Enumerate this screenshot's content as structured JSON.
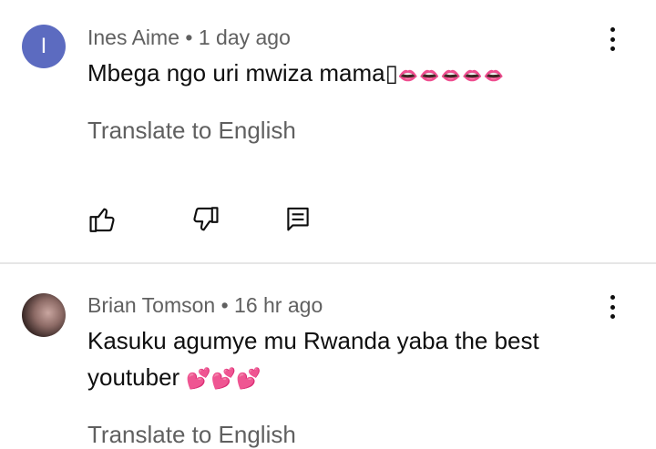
{
  "comments": [
    {
      "avatar_letter": "I",
      "author": "Ines Aime",
      "separator": "•",
      "time": "1 day ago",
      "text": "Mbega ngo uri mwiza mama",
      "missing_glyph": "▯",
      "emoji": "👄👄👄👄👄",
      "translate_label": "Translate to English",
      "menu_icon": "more-vert-icon",
      "actions": {
        "like_icon": "thumb-up-icon",
        "dislike_icon": "thumb-down-icon",
        "reply_icon": "reply-comment-icon"
      }
    },
    {
      "avatar": "profile-photo",
      "author": "Brian Tomson",
      "separator": "•",
      "time": "16 hr ago",
      "text": "Kasuku agumye mu Rwanda yaba the best youtuber",
      "emoji": "💕💕💕",
      "translate_label": "Translate to English",
      "menu_icon": "more-vert-icon"
    }
  ],
  "colors": {
    "avatar_bg": "#5c6bc0",
    "meta": "#606060",
    "text": "#0f0f0f",
    "divider": "#e6e6e6"
  }
}
